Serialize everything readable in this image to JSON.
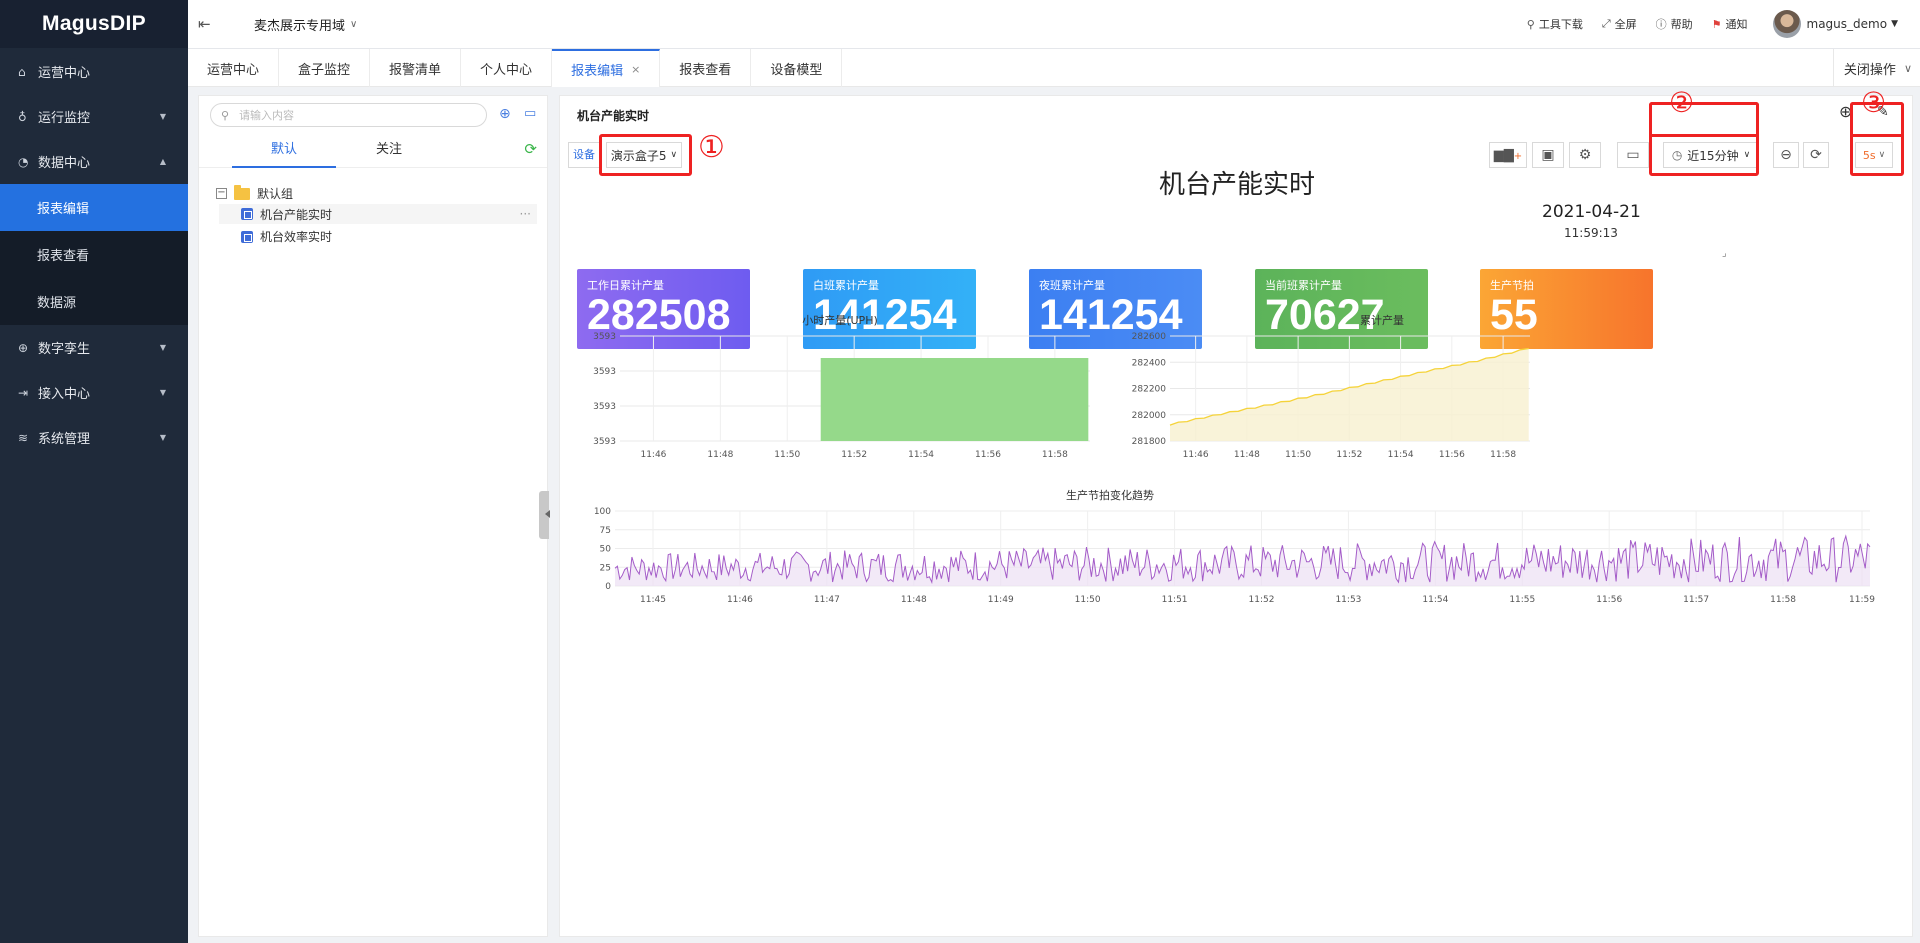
{
  "app": {
    "logo": "MagusDIP",
    "domain": "麦杰展示专用域"
  },
  "sidebar": {
    "items": [
      {
        "label": "运营中心",
        "icon": "home-icon"
      },
      {
        "label": "运行监控",
        "icon": "bulb-icon"
      },
      {
        "label": "数据中心",
        "icon": "pie-chart-icon"
      },
      {
        "label": "数字孪生",
        "icon": "globe-icon"
      },
      {
        "label": "接入中心",
        "icon": "login-icon"
      },
      {
        "label": "系统管理",
        "icon": "layers-icon"
      }
    ],
    "data_center_sub": [
      "报表编辑",
      "报表查看",
      "数据源"
    ]
  },
  "header": {
    "links": {
      "tools": "工具下载",
      "fullscreen": "全屏",
      "help": "帮助",
      "notify": "通知"
    },
    "user": "magus_demo"
  },
  "tabs": [
    "运营中心",
    "盒子监控",
    "报警清单",
    "个人中心",
    "报表编辑",
    "报表查看",
    "设备模型"
  ],
  "tab_close_ops": "关闭操作",
  "left_panel": {
    "search_placeholder": "请输入内容",
    "tabs": [
      "默认",
      "关注"
    ],
    "tree": {
      "group": "默认组",
      "items": [
        "机台产能实时",
        "机台效率实时"
      ],
      "item_more": "···"
    }
  },
  "main": {
    "panel_title": "机台产能实时",
    "device_label": "设备",
    "device_value": "演示盒子5",
    "time_range": "近15分钟",
    "refresh_interval": "5s",
    "annotations": [
      "①",
      "②",
      "③"
    ],
    "dashboard_title": "机台产能实时",
    "date": "2021-04-21",
    "time": "11:59:13"
  },
  "kpis": [
    {
      "label": "工作日累计产量",
      "value": "282508",
      "gradient": [
        "#8e6bf0",
        "#6e5cf0"
      ]
    },
    {
      "label": "白班累计产量",
      "value": "141254",
      "gradient": [
        "#2f9bf5",
        "#33b1f7"
      ]
    },
    {
      "label": "夜班累计产量",
      "value": "141254",
      "gradient": [
        "#3c7ff2",
        "#4b8cf4"
      ]
    },
    {
      "label": "当前班累计产量",
      "value": "70627",
      "gradient": [
        "#5cb35a",
        "#6bbd5e"
      ]
    },
    {
      "label": "生产节拍",
      "value": "55",
      "gradient": [
        "#fba635",
        "#f7742c"
      ]
    }
  ],
  "chart_data": [
    {
      "type": "bar",
      "title": "小时产量(UPH)",
      "x_ticks": [
        "11:46",
        "11:48",
        "11:50",
        "11:52",
        "11:54",
        "11:56",
        "11:58"
      ],
      "y_ticks": [
        "3593",
        "3593",
        "3593",
        "3593"
      ],
      "bars": [
        {
          "x_start": "11:51",
          "x_end": "11:59",
          "value": 3593
        }
      ],
      "color": "#95d98a"
    },
    {
      "type": "area",
      "title": "累计产量",
      "x_ticks": [
        "11:46",
        "11:48",
        "11:50",
        "11:52",
        "11:54",
        "11:56",
        "11:58"
      ],
      "y_ticks": [
        282600,
        282400,
        282200,
        282000,
        281800
      ],
      "ylim": [
        281800,
        282600
      ],
      "series": [
        {
          "x": [
            "11:45",
            "11:47",
            "11:49",
            "11:51",
            "11:53",
            "11:55",
            "11:57",
            "11:59"
          ],
          "values": [
            281925,
            282005,
            282080,
            282160,
            282245,
            282330,
            282410,
            282505
          ]
        }
      ],
      "color": "#f5d33a"
    },
    {
      "type": "area",
      "title": "生产节拍变化趋势",
      "x_ticks": [
        "11:45",
        "11:46",
        "11:47",
        "11:48",
        "11:49",
        "11:50",
        "11:51",
        "11:52",
        "11:53",
        "11:54",
        "11:55",
        "11:56",
        "11:57",
        "11:58",
        "11:59"
      ],
      "y_ticks": [
        100,
        75,
        50,
        25,
        0
      ],
      "ylim": [
        0,
        100
      ],
      "series": [
        {
          "range": [
            5,
            60
          ],
          "values": []
        }
      ],
      "color": "#a45cc8"
    }
  ]
}
